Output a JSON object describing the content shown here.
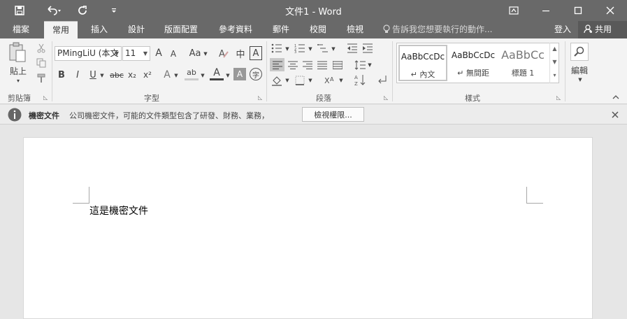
{
  "window": {
    "title": "文件1 - Word",
    "title_icons": {
      "save": "save-icon",
      "undo": "undo-icon",
      "redo": "redo-icon",
      "customize": "customize-qat-icon",
      "ribbon_display": "ribbon-display-icon",
      "minimize": "minimize-icon",
      "maximize": "maximize-icon",
      "close": "close-icon"
    }
  },
  "tabs": [
    "檔案",
    "常用",
    "插入",
    "設計",
    "版面配置",
    "參考資料",
    "郵件",
    "校閱",
    "檢視"
  ],
  "active_tab": "常用",
  "tell_me": "告訴我您想要執行的動作...",
  "account": {
    "login": "登入",
    "share": "共用"
  },
  "ribbon": {
    "clipboard": {
      "paste": "貼上",
      "label": "剪貼簿"
    },
    "font": {
      "font_name": "PMingLiU (本文",
      "font_size": "11",
      "grow": "A",
      "shrink": "A",
      "case": "Aa",
      "phonetic": "中",
      "border_char": "A",
      "bold": "B",
      "italic": "I",
      "underline": "U",
      "strike": "abc",
      "sub": "x₂",
      "sup": "x²",
      "effects": "A",
      "highlight": "ab",
      "color": "A",
      "shade": "A",
      "enclose": "字",
      "label": "字型"
    },
    "paragraph": {
      "label": "段落"
    },
    "styles": {
      "items": [
        {
          "sample": "AaBbCcDc",
          "name": "↵ 內文"
        },
        {
          "sample": "AaBbCcDc",
          "name": "↵ 無間距"
        },
        {
          "sample": "AaBbCc",
          "name": "標題 1"
        }
      ],
      "label": "樣式"
    },
    "editing": {
      "label": "編輯"
    }
  },
  "infobar": {
    "title": "機密文件",
    "message": "公司機密文件，可能的文件類型包含了研發、財務、業務，",
    "button": "檢視權限..."
  },
  "document": {
    "text": "這是機密文件"
  }
}
